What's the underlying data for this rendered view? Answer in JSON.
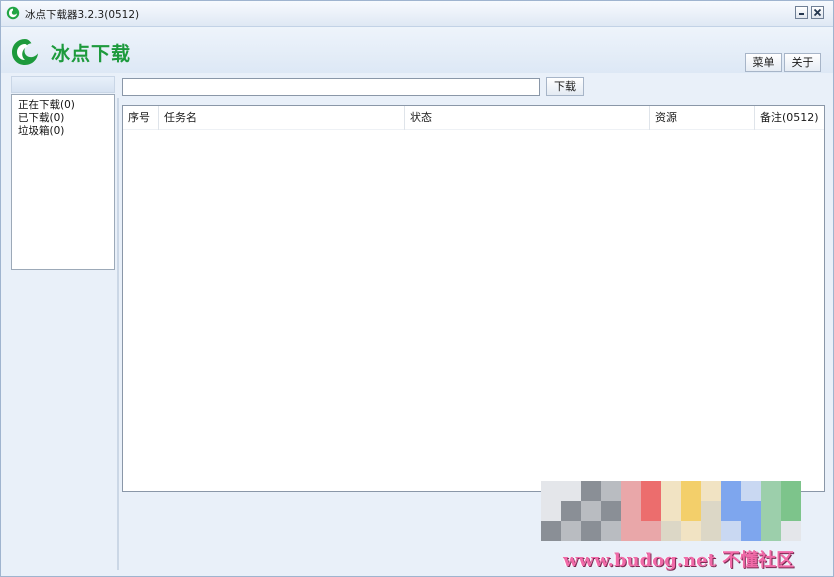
{
  "window": {
    "title": "冰点下载器3.2.3(0512)"
  },
  "header": {
    "logo_text": "冰点下载",
    "menu_label": "菜单",
    "about_label": "关于"
  },
  "sidebar": {
    "items": [
      {
        "label": "正在下载(0)"
      },
      {
        "label": "已下载(0)"
      },
      {
        "label": "垃圾箱(0)"
      }
    ]
  },
  "toolbar": {
    "url_value": "",
    "download_label": "下载"
  },
  "table": {
    "columns": [
      "序号",
      "任务名",
      "状态",
      "资源",
      "备注(0512)"
    ],
    "rows": []
  },
  "watermark": {
    "text": "www.budog.net 不懂社区"
  },
  "colors": {
    "brand_green": "#1d9a3c",
    "watermark_pink": "#f06aa8"
  }
}
